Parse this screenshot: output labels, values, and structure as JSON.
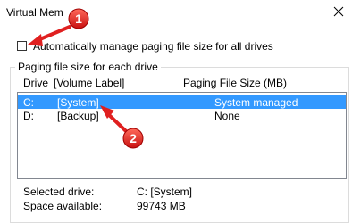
{
  "window": {
    "title": "Virtual Mem",
    "close_icon": "close-icon"
  },
  "auto_manage": {
    "label": "Automatically manage paging file size for all drives",
    "checked": false
  },
  "group": {
    "legend": "Paging file size for each drive"
  },
  "list": {
    "columns": [
      "Drive",
      "[Volume Label]",
      "Paging File Size (MB)"
    ],
    "rows": [
      {
        "drive": "C:",
        "label": "[System]",
        "size": "System managed",
        "selected": true
      },
      {
        "drive": "D:",
        "label": "[Backup]",
        "size": "None",
        "selected": false
      }
    ]
  },
  "details": {
    "selected_drive_label": "Selected drive:",
    "selected_drive_value": "C:  [System]",
    "space_label": "Space available:",
    "space_value": "99743 MB"
  },
  "annotations": {
    "badge1": "1",
    "badge2": "2",
    "accent": "#e02020"
  }
}
